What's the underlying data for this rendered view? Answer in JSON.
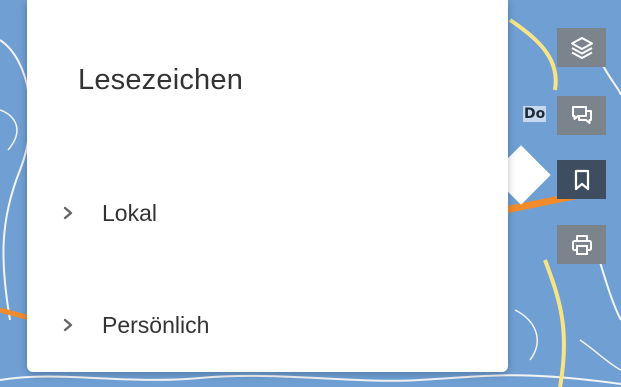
{
  "map": {
    "place_label": "Do",
    "colors": {
      "water": "#6f9fd3",
      "road_major": "#f28b2c",
      "road_minor": "#f7e486",
      "road_white": "#f4f4f4"
    }
  },
  "bookmarks_panel": {
    "title": "Lesezeichen",
    "items": [
      {
        "label": "Lokal",
        "icon": "chevron-right-icon"
      },
      {
        "label": "Persönlich",
        "icon": "chevron-right-icon"
      }
    ]
  },
  "toolbar": {
    "buttons": [
      {
        "icon": "layers-icon",
        "active": false
      },
      {
        "icon": "comments-icon",
        "active": false
      },
      {
        "icon": "bookmark-icon",
        "active": true
      },
      {
        "icon": "print-icon",
        "active": false
      }
    ],
    "colors": {
      "button": "#7b848d",
      "active": "#3e4e60",
      "icon": "#ffffff"
    }
  }
}
